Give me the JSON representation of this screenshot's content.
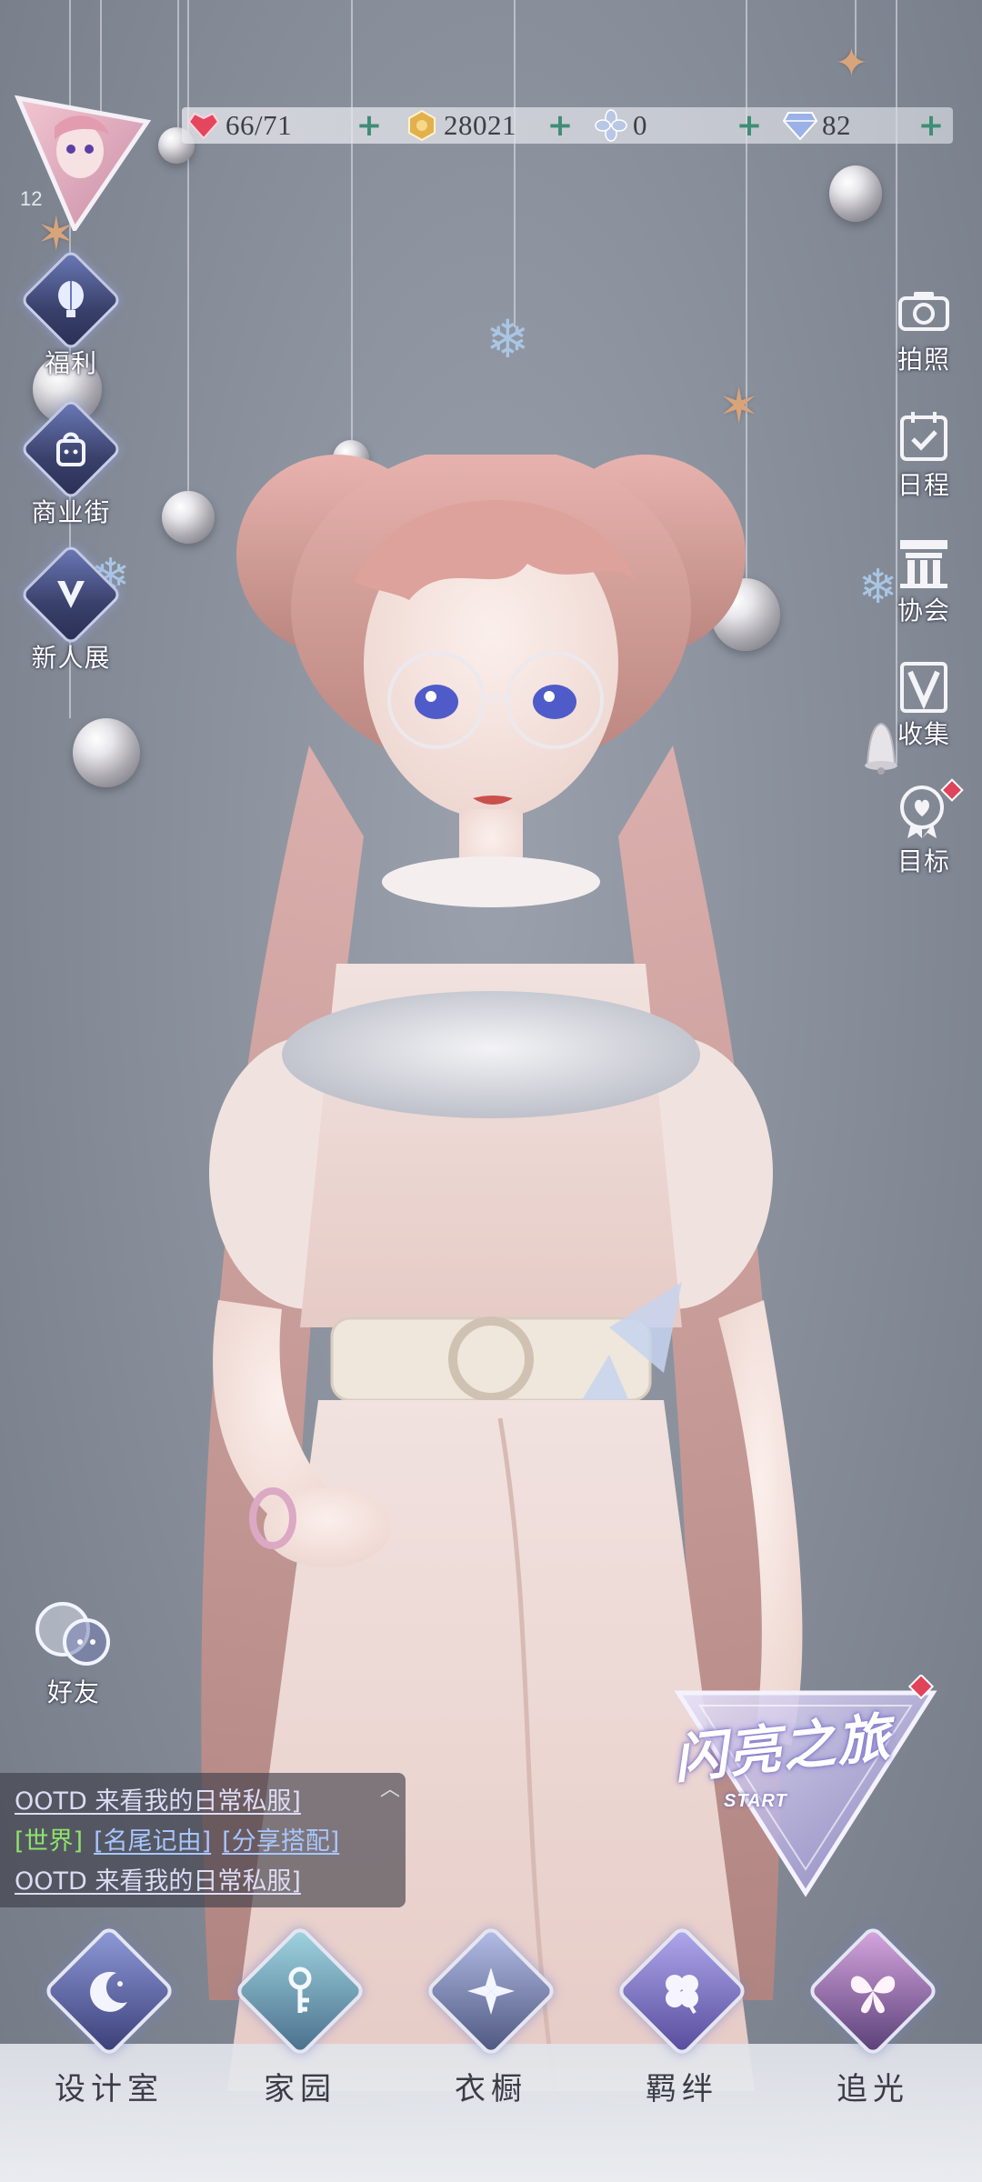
{
  "player": {
    "level": "12"
  },
  "resources": {
    "stamina": "66/71",
    "gold": "28021",
    "crystal": "0",
    "diamond": "82"
  },
  "left_menu": {
    "welfare": "福利",
    "shopping_street": "商业街",
    "newbie_show": "新人展",
    "friends": "好友"
  },
  "right_menu": {
    "photo": "拍照",
    "schedule": "日程",
    "guild": "协会",
    "collection": "收集",
    "goals": "目标"
  },
  "chat": {
    "line1": "OOTD 来看我的日常私服]",
    "channel": "[世界]",
    "tag1": "[名尾记由]",
    "tag2": "[分享搭配]",
    "line3": "OOTD 来看我的日常私服]"
  },
  "start_journey": {
    "title": "闪亮之旅",
    "sub": "START"
  },
  "bottom_nav": {
    "design_room": "设计室",
    "home": "家园",
    "wardrobe": "衣橱",
    "bonds": "羁绊",
    "chase_light": "追光"
  },
  "colors": {
    "accent_green": "#3f8d76",
    "chat_channel": "#8de36d",
    "chat_link": "#a7c6ff",
    "badge_red": "#e0445a"
  }
}
